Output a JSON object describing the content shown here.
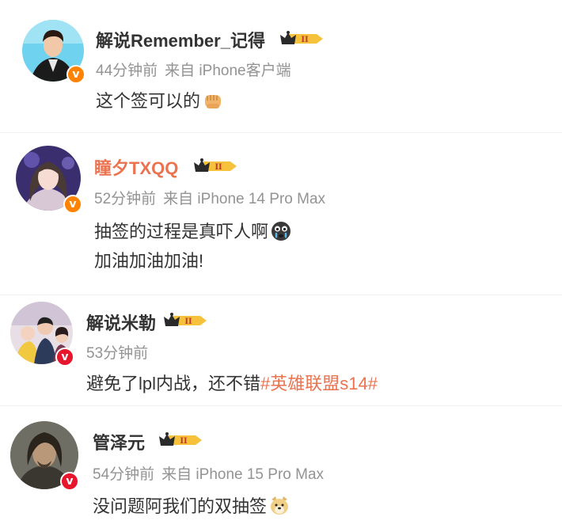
{
  "comments": [
    {
      "username": "解说Remember_记得",
      "time": "44分钟前",
      "source": "来自 iPhone客户端",
      "text": "这个签可以的",
      "emoji": "fist-emoji",
      "verified": "v",
      "badge": "II"
    },
    {
      "username": "瞳夕TXQQ",
      "time": "52分钟前",
      "source": "来自 iPhone 14 Pro Max",
      "text_line1": "抽签的过程是真吓人啊",
      "text_line2": "加油加油加油!",
      "emoji": "crying-face-emoji",
      "verified": "v",
      "badge": "II"
    },
    {
      "username": "解说米勒",
      "time": "53分钟前",
      "text": "避免了lpl内战，还不错",
      "hashtag": "#英雄联盟s14#",
      "verified": "v",
      "badge": "II"
    },
    {
      "username": "管泽元",
      "time": "54分钟前",
      "source": "来自 iPhone 15 Pro Max",
      "text": "没问题阿我们的双抽签",
      "emoji": "doge-emoji",
      "verified": "v",
      "badge": "II"
    }
  ],
  "colors": {
    "username_default": "#333333",
    "username_vip": "#eb7350",
    "meta": "#939393",
    "hashtag": "#eb7350",
    "verified_orange": "#ff8200",
    "verified_red": "#e6162d"
  }
}
